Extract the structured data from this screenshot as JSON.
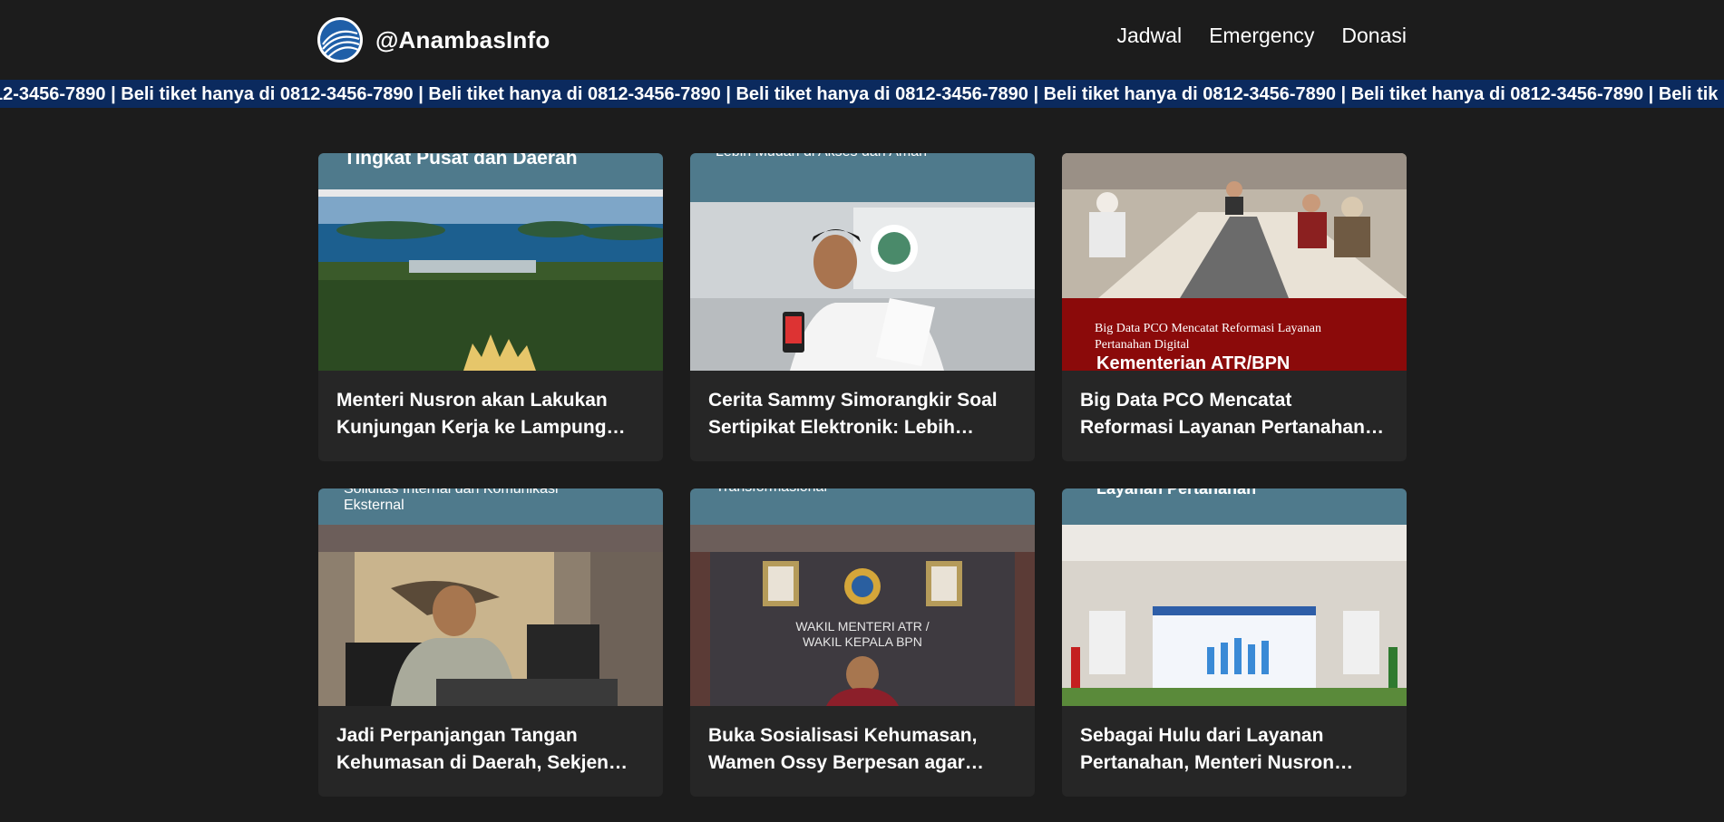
{
  "header": {
    "site_name": "@AnambasInfo",
    "nav": [
      "Jadwal",
      "Emergency",
      "Donasi"
    ]
  },
  "ticker": {
    "text": "12-3456-7890 | Beli tiket hanya di 0812-3456-7890 | Beli tiket hanya di 0812-3456-7890 | Beli tiket hanya di 0812-3456-7890 | Beli tiket hanya di 0812-3456-7890 | Beli tiket hanya di 0812-3456-7890 | Beli tik"
  },
  "articles": [
    {
      "title": "Menteri Nusron akan Lakukan Kunjungan Kerja ke Lampung…",
      "image_caption": "Tingkat Pusat dan Daerah"
    },
    {
      "title": "Cerita Sammy Simorangkir Soal Sertipikat Elektronik: Lebih Muda…",
      "image_caption": "Lebih Mudah di Akses dan Aman"
    },
    {
      "title": "Big Data PCO Mencatat Reformasi Layanan Pertanahan Digital…",
      "image_caption_line1": "Big Data PCO Mencatat Reformasi Layanan",
      "image_caption_line2": "Pertanahan Digital",
      "image_caption_brand": "Kementerian ATR/BPN"
    },
    {
      "title": "Jadi Perpanjangan Tangan Kehumasan di Daerah, Sekjen…",
      "image_caption_line1": "Soliditas Internal dan Komunikasi",
      "image_caption_line2": "Eksternal"
    },
    {
      "title": "Buka Sosialisasi Kehumasan, Wamen Ossy Berpesan agar…",
      "image_caption": "Transformasional",
      "sign_line1": "WAKIL MENTERI ATR /",
      "sign_line2": "WAKIL KEPALA BPN"
    },
    {
      "title": "Sebagai Hulu dari Layanan Pertanahan, Menteri Nusron Ingi…",
      "image_caption": "Layanan Pertanahan"
    }
  ],
  "colors": {
    "background": "#1c1c1c",
    "ticker": "#0b2a5e",
    "card": "#262626",
    "banner_teal": "#4f7a8c",
    "banner_red": "#8b0a0a"
  }
}
